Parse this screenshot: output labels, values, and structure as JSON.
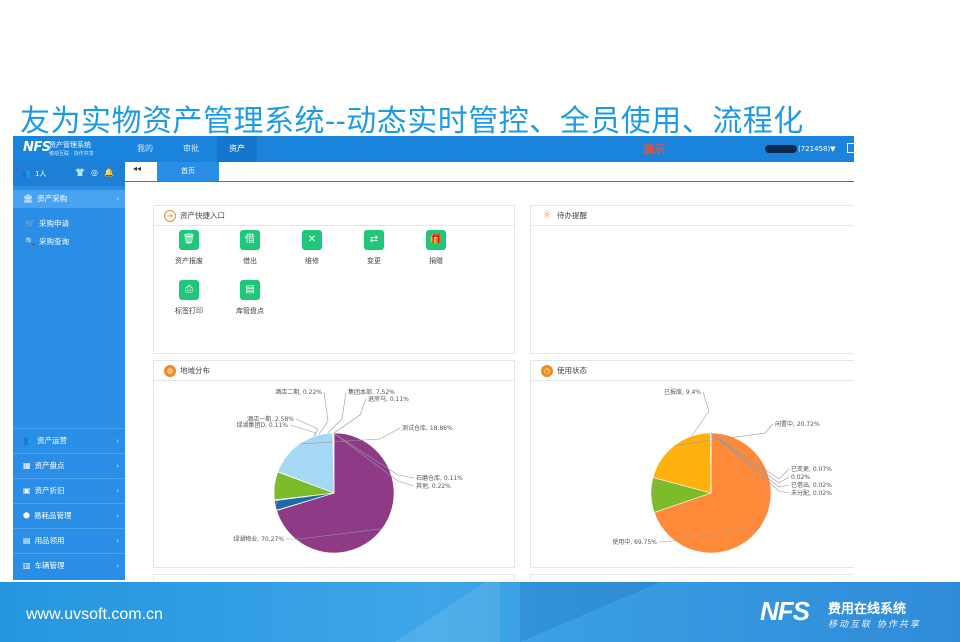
{
  "slide_title": "友为实物资产管理系统--动态实时管控、全员使用、流程化",
  "app": {
    "logo": {
      "mark": "NFS",
      "name": "资产管理系统",
      "sub": "移动互联 · 协作共享"
    },
    "nav_tabs": [
      "我的",
      "审批",
      "资产"
    ],
    "active_nav": "资产",
    "demo_label": "演示",
    "user_id": "(721458)▼",
    "sidebar": {
      "people": "1人",
      "status_icons": [
        "shirt-icon",
        "badge-icon",
        "bell-icon"
      ],
      "active_group": "资产采购",
      "sub_items": [
        "采购申请",
        "采购查询"
      ],
      "groups": [
        "资产运营",
        "资产盘点",
        "资产折旧",
        "易耗品管理",
        "用品领用",
        "车辆管理"
      ]
    },
    "tabstrip": {
      "back": "◂◂",
      "home": "首页"
    },
    "quick_panel": {
      "title": "资产快捷入口",
      "items": [
        {
          "label": "资产报废",
          "icon": "trash-icon",
          "glyph": "🗑"
        },
        {
          "label": "借出",
          "icon": "borrow-icon",
          "glyph": "借"
        },
        {
          "label": "维修",
          "icon": "tools-icon",
          "glyph": "✕"
        },
        {
          "label": "变更",
          "icon": "change-icon",
          "glyph": "⇄"
        },
        {
          "label": "捐赠",
          "icon": "gift-icon",
          "glyph": "🎁"
        },
        {
          "label": "标签打印",
          "icon": "printer-icon",
          "glyph": "⎙"
        },
        {
          "label": "库管盘点",
          "icon": "inventory-icon",
          "glyph": "▤"
        }
      ]
    },
    "todo_panel": {
      "title": "待办提醒"
    },
    "region_panel": {
      "title": "地域分布"
    },
    "status_panel": {
      "title": "使用状态"
    }
  },
  "chart_data": [
    {
      "type": "pie",
      "title": "地域分布",
      "slices": [
        {
          "label": "绿湖物业",
          "value": 70.27,
          "color": "#8e3a87"
        },
        {
          "label": "绿湖集团D",
          "value": 0.11,
          "color": "#d1d1d1"
        },
        {
          "label": "酒店一期",
          "value": 2.58,
          "color": "#1f6aa8"
        },
        {
          "label": "酒店二期",
          "value": 0.22,
          "color": "#b0b0b0"
        },
        {
          "label": "集团本部",
          "value": 7.52,
          "color": "#7cbb2a"
        },
        {
          "label": "退房马",
          "value": 0.11,
          "color": "#c5c5c5"
        },
        {
          "label": "测试仓库",
          "value": 18.86,
          "color": "#a4d8f5"
        },
        {
          "label": "石磨仓库",
          "value": 0.11,
          "color": "#e0e0e0"
        },
        {
          "label": "其他",
          "value": 0.22,
          "color": "#bcbcbc"
        }
      ],
      "display_labels": [
        "绿湖物业, 70.27%",
        "绿湖集团D, 0.11%",
        "酒店一期, 2.58%",
        "酒店二期, 0.22%",
        "集团本部, 7.52%",
        "退房马, 0.11%",
        "测试仓库, 18.86%",
        "石磨仓库, 0.11%",
        "其他, 0.22%"
      ]
    },
    {
      "type": "pie",
      "title": "使用状态",
      "slices": [
        {
          "label": "使用中",
          "value": 69.75,
          "color": "#ff8b3a"
        },
        {
          "label": "已报废",
          "value": 9.4,
          "color": "#7cbb2a"
        },
        {
          "label": "闲置中",
          "value": 20.72,
          "color": "#ffb20d"
        },
        {
          "label": "已变更",
          "value": 0.07,
          "color": "#dddddd"
        },
        {
          "label": "",
          "value": 0.02,
          "color": "#cccccc"
        },
        {
          "label": "已借出",
          "value": 0.02,
          "color": "#bbbbbb"
        },
        {
          "label": "未分配",
          "value": 0.02,
          "color": "#aaaaaa"
        }
      ],
      "display_labels": [
        "使用中, 69.75%",
        "已报废, 9.4%",
        "闲置中, 20.72%",
        "已变更, 0.07%",
        "0.02%",
        "已借出, 0.02%",
        "未分配, 0.02%"
      ]
    }
  ],
  "footer": {
    "url": "www.uvsoft.com.cn",
    "brand": "NFS",
    "brand_name": "费用在线系统",
    "brand_sub": "移动互联 协作共享"
  }
}
